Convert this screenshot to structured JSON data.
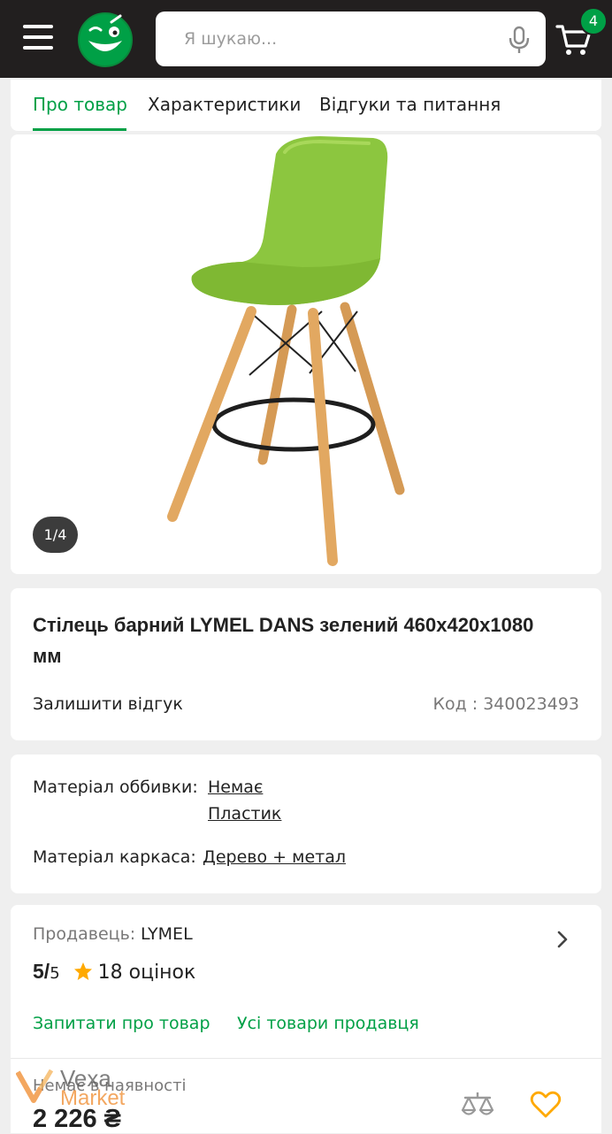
{
  "header": {
    "search_placeholder": "Я шукаю...",
    "cart_count": "4",
    "accent_color": "#00a046",
    "bg_color": "#221f1f"
  },
  "tabs": [
    {
      "label": "Про товар",
      "active": true
    },
    {
      "label": "Характеристики",
      "active": false
    },
    {
      "label": "Відгуки та питання",
      "active": false
    }
  ],
  "gallery": {
    "counter": "1/4"
  },
  "product": {
    "title": "Стілець барний LYMEL DANS зелений 460x420x1080 мм",
    "review_link": "Залишити відгук",
    "code": "Код :  340023493"
  },
  "specs": {
    "upholstery_label": "Матеріал оббивки:",
    "upholstery_values": [
      "Немає",
      "Пластик"
    ],
    "frame_label": "Матеріал каркаса:",
    "frame_value": "Дерево + метал"
  },
  "seller": {
    "label": "Продавець:",
    "name": "LYMEL",
    "rating_value": "5/",
    "rating_of": "5",
    "rating_count": "18 оцінок",
    "ask_link": "Запитати про товар",
    "all_goods_link": "Усі товари продавця"
  },
  "purchase": {
    "stock_status": "Немає в наявності",
    "price": "2 226 ₴"
  },
  "watermark": {
    "line1": "Vexa",
    "line2": "Market"
  },
  "icons": [
    "menu-icon",
    "logo-icon",
    "microphone-icon",
    "cart-icon",
    "chevron-right-icon",
    "star-icon",
    "compare-icon",
    "heart-icon"
  ]
}
